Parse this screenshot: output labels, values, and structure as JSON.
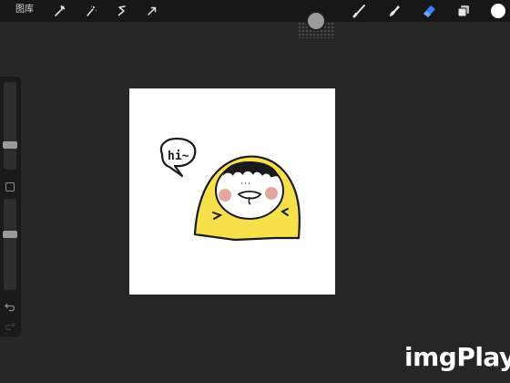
{
  "topbar": {
    "gallery_label": "图库",
    "actions": [
      {
        "name": "actions-wrench-icon"
      },
      {
        "name": "adjustments-wand-icon"
      },
      {
        "name": "selection-s-icon"
      },
      {
        "name": "transform-arrow-icon"
      }
    ],
    "tools": [
      {
        "name": "brush-icon",
        "active": false
      },
      {
        "name": "smudge-icon",
        "active": false
      },
      {
        "name": "eraser-icon",
        "active": true
      },
      {
        "name": "layers-icon",
        "active": false
      },
      {
        "name": "color-swatch",
        "color": "#ffffff"
      }
    ]
  },
  "sidebar": {
    "brush_size_level": 0.26,
    "opacity_level": 0.62,
    "icons": [
      "modify-square-icon",
      "undo-icon",
      "redo-icon"
    ]
  },
  "canvas": {
    "background": "#ffffff",
    "speech_bubble_text": "hi~",
    "character_color": "#f7e04b",
    "cheek_color": "#e2a8a0"
  },
  "watermark": {
    "text": "imgPlay"
  },
  "colors": {
    "app_background": "#262626",
    "toolbar": "#171717",
    "active_tool": "#3a82f7"
  }
}
